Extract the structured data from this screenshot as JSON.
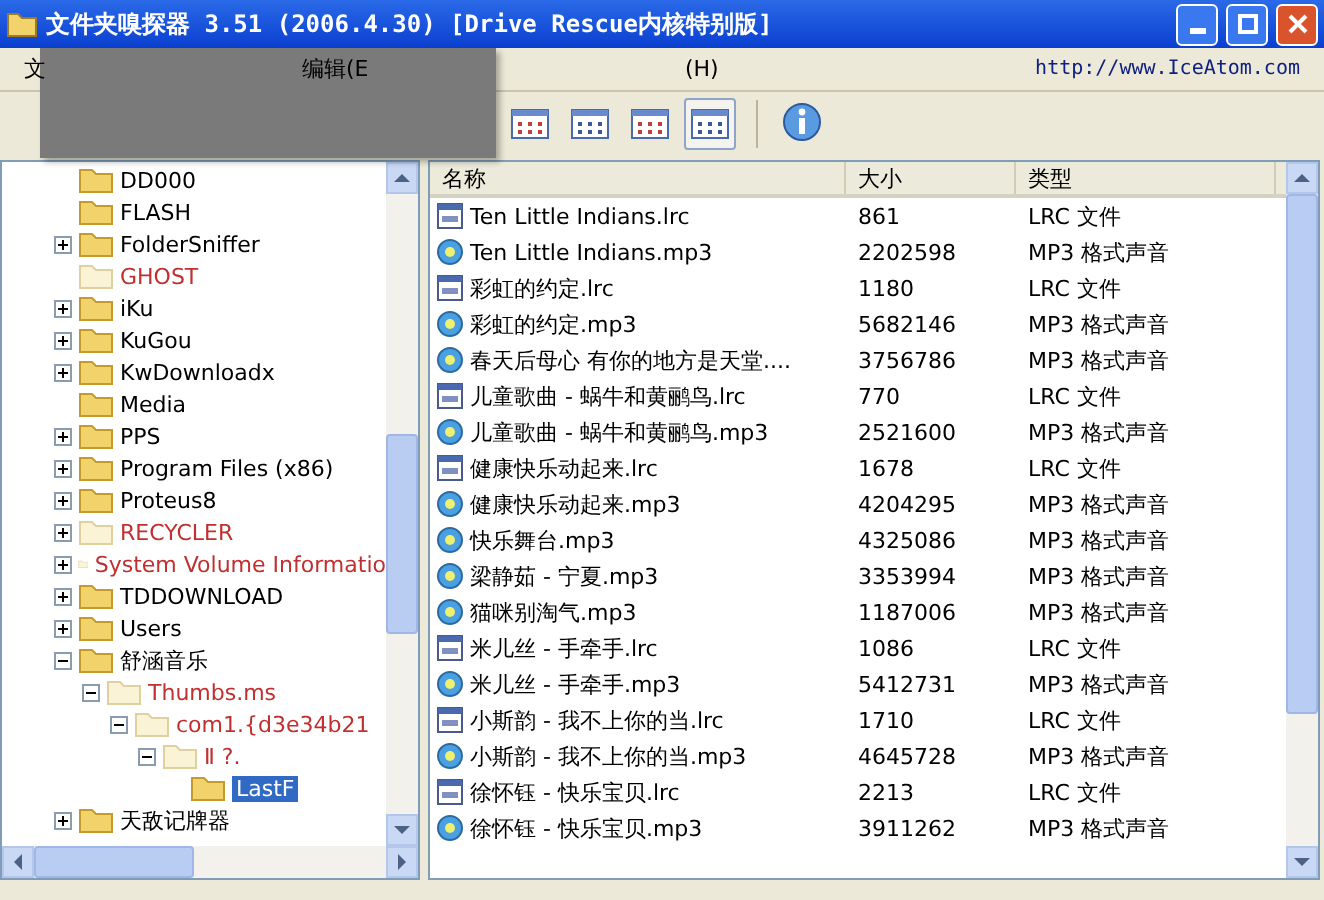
{
  "window": {
    "title": "文件夹嗅探器  3.51  (2006.4.30)  [Drive Rescue内核特别版]"
  },
  "menu": [
    {
      "label": "文"
    },
    {
      "label": "编辑(E"
    },
    {
      "label": "(H)"
    }
  ],
  "website": "http://www.IceAtom.com",
  "view_buttons": [
    {
      "selected": false
    },
    {
      "selected": false
    },
    {
      "selected": false
    },
    {
      "selected": true
    }
  ],
  "tree": [
    {
      "label": "DD000",
      "expandable": false,
      "deleted": false,
      "selected": false
    },
    {
      "label": "FLASH",
      "expandable": false,
      "deleted": false,
      "selected": false
    },
    {
      "label": "FolderSniffer",
      "expandable": true,
      "deleted": false,
      "selected": false
    },
    {
      "label": "GHOST",
      "expandable": false,
      "deleted": true,
      "selected": false
    },
    {
      "label": "iKu",
      "expandable": true,
      "deleted": false,
      "selected": false
    },
    {
      "label": "KuGou",
      "expandable": true,
      "deleted": false,
      "selected": false
    },
    {
      "label": "KwDownloadx",
      "expandable": true,
      "deleted": false,
      "selected": false
    },
    {
      "label": "Media",
      "expandable": false,
      "deleted": false,
      "selected": false
    },
    {
      "label": "PPS",
      "expandable": true,
      "deleted": false,
      "selected": false
    },
    {
      "label": "Program Files (x86)",
      "expandable": true,
      "deleted": false,
      "selected": false
    },
    {
      "label": "Proteus8",
      "expandable": true,
      "deleted": false,
      "selected": false
    },
    {
      "label": "RECYCLER",
      "expandable": true,
      "deleted": true,
      "selected": false
    },
    {
      "label": "System Volume Informatio",
      "expandable": true,
      "deleted": true,
      "selected": false
    },
    {
      "label": "TDDOWNLOAD",
      "expandable": true,
      "deleted": false,
      "selected": false
    },
    {
      "label": "Users",
      "expandable": true,
      "deleted": false,
      "selected": false
    },
    {
      "label": "舒涵音乐",
      "expandable": true,
      "deleted": false,
      "selected": false,
      "children": [
        {
          "label": "Thumbs.ms",
          "expandable": true,
          "deleted": true,
          "selected": false,
          "children": [
            {
              "label": "com1.{d3e34b21",
              "expandable": true,
              "deleted": true,
              "selected": false,
              "children": [
                {
                  "label": "Ⅱ  ?.",
                  "expandable": true,
                  "deleted": true,
                  "selected": false,
                  "children": [
                    {
                      "label": "LastF",
                      "expandable": false,
                      "deleted": false,
                      "selected": true
                    }
                  ]
                }
              ]
            }
          ]
        }
      ]
    },
    {
      "label": "天敌记牌器",
      "expandable": true,
      "deleted": false,
      "selected": false
    }
  ],
  "table": {
    "columns": [
      "名称",
      "大小",
      "类型"
    ],
    "rows": [
      {
        "kind": "lrc",
        "name": "Ten Little Indians.lrc",
        "size": "861",
        "type": "LRC 文件"
      },
      {
        "kind": "mp3",
        "name": "Ten Little Indians.mp3",
        "size": "2202598",
        "type": "MP3 格式声音"
      },
      {
        "kind": "lrc",
        "name": "彩虹的约定.lrc",
        "size": "1180",
        "type": "LRC 文件"
      },
      {
        "kind": "mp3",
        "name": "彩虹的约定.mp3",
        "size": "5682146",
        "type": "MP3 格式声音"
      },
      {
        "kind": "mp3",
        "name": "春天后母心 有你的地方是天堂....",
        "size": "3756786",
        "type": "MP3 格式声音"
      },
      {
        "kind": "lrc",
        "name": "儿童歌曲 - 蜗牛和黄鹂鸟.lrc",
        "size": "770",
        "type": "LRC 文件"
      },
      {
        "kind": "mp3",
        "name": "儿童歌曲 - 蜗牛和黄鹂鸟.mp3",
        "size": "2521600",
        "type": "MP3 格式声音"
      },
      {
        "kind": "lrc",
        "name": "健康快乐动起来.lrc",
        "size": "1678",
        "type": "LRC 文件"
      },
      {
        "kind": "mp3",
        "name": "健康快乐动起来.mp3",
        "size": "4204295",
        "type": "MP3 格式声音"
      },
      {
        "kind": "mp3",
        "name": "快乐舞台.mp3",
        "size": "4325086",
        "type": "MP3 格式声音"
      },
      {
        "kind": "mp3",
        "name": "梁静茹 - 宁夏.mp3",
        "size": "3353994",
        "type": "MP3 格式声音"
      },
      {
        "kind": "mp3",
        "name": "猫咪别淘气.mp3",
        "size": "1187006",
        "type": "MP3 格式声音"
      },
      {
        "kind": "lrc",
        "name": "米儿丝 - 手牵手.lrc",
        "size": "1086",
        "type": "LRC 文件"
      },
      {
        "kind": "mp3",
        "name": "米儿丝 - 手牵手.mp3",
        "size": "5412731",
        "type": "MP3 格式声音"
      },
      {
        "kind": "lrc",
        "name": "小斯韵 - 我不上你的当.lrc",
        "size": "1710",
        "type": "LRC 文件"
      },
      {
        "kind": "mp3",
        "name": "小斯韵 - 我不上你的当.mp3",
        "size": "4645728",
        "type": "MP3 格式声音"
      },
      {
        "kind": "lrc",
        "name": "徐怀钰 - 快乐宝贝.lrc",
        "size": "2213",
        "type": "LRC 文件"
      },
      {
        "kind": "mp3",
        "name": "徐怀钰 - 快乐宝贝.mp3",
        "size": "3911262",
        "type": "MP3 格式声音"
      }
    ]
  }
}
